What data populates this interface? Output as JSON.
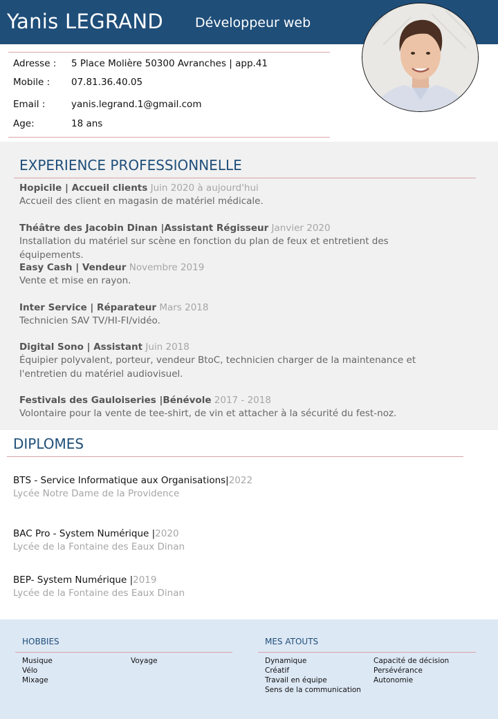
{
  "header": {
    "name": "Yanis LEGRAND",
    "job_title": "Développeur web",
    "accent_color": "#1f4e79"
  },
  "contact": [
    {
      "label": "Adresse :",
      "value": "5 Place Molière 50300 Avranches | app.41"
    },
    {
      "label": "Mobile :",
      "value": "07.81.36.40.05"
    },
    {
      "label": "Email :",
      "value": "yanis.legrand.1@gmail.com"
    },
    {
      "label": "Age:",
      "value": "18 ans"
    }
  ],
  "experience": {
    "title": "EXPERIENCE PROFESSIONNELLE",
    "items": [
      {
        "company": "Hopicile |  Accueil clients",
        "date": " Juin 2020 à aujourd'hui",
        "desc": "Accueil des client en magasin de matériel médicale."
      },
      {
        "company": "Théâtre des Jacobin Dinan |Assistant Régisseur",
        "date": " Janvier 2020",
        "desc": "Installation du matériel sur scène en fonction du plan de feux et entretient des équipements."
      },
      {
        "company": "Easy Cash | Vendeur",
        "date": " Novembre 2019",
        "desc": "Vente et mise en rayon."
      },
      {
        "company": "Inter Service | Réparateur",
        "date": " Mars 2018",
        "desc": "Technicien SAV TV/HI-FI/vidéo."
      },
      {
        "company": "Digital Sono | Assistant",
        "date": "  Juin 2018",
        "desc": "Équipier polyvalent, porteur, vendeur BtoC, technicien charger de la maintenance et l'entretien du matériel audiovisuel."
      },
      {
        "company": "Festivals des Gauloiseries |Bénévole",
        "date": " 2017 - 2018",
        "desc": "Volontaire pour la vente de tee-shirt, de vin et attacher à la sécurité du fest-noz."
      }
    ]
  },
  "diplomas": {
    "title": "DIPLOMES",
    "items": [
      {
        "name": "BTS -  Service Informatique aux Organisations|",
        "year": "2022",
        "school": "Lycée Notre Dame de la Providence"
      },
      {
        "name": "BAC Pro - System Numérique |",
        "year": "2020",
        "school": "Lycée de la Fontaine des Eaux Dinan"
      },
      {
        "name": "BEP- System Numérique |",
        "year": "2019",
        "school": "Lycée de la Fontaine des Eaux Dinan"
      }
    ]
  },
  "hobbies": {
    "title": "HOBBIES",
    "items": [
      "Musique",
      "Vélo",
      "Mixage",
      "Voyage"
    ]
  },
  "atouts": {
    "title": "MES ATOUTS",
    "items": [
      "Dynamique",
      "Créatif",
      "Travail en équipe",
      "Sens de la communication",
      "Capacité de décision",
      "Persévérance",
      "Autonomie"
    ]
  }
}
